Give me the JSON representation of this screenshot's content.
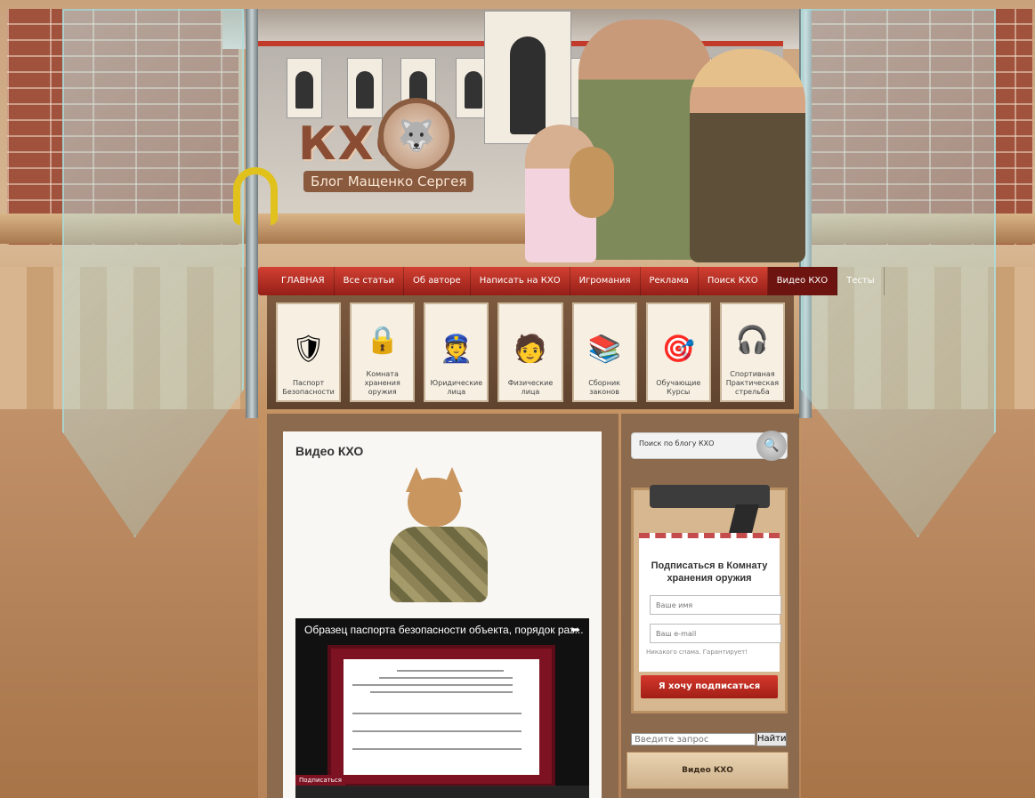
{
  "logo": {
    "letters": "КХО",
    "subtitle": "Блог Мащенко Сергея"
  },
  "nav": {
    "items": [
      {
        "label": "ГЛАВНАЯ"
      },
      {
        "label": "Все статьи"
      },
      {
        "label": "Об авторе"
      },
      {
        "label": "Написать на КХО"
      },
      {
        "label": "Игромания"
      },
      {
        "label": "Реклама"
      },
      {
        "label": "Поиск КХО"
      },
      {
        "label": "Видео КХО"
      },
      {
        "label": "Тесты"
      }
    ],
    "active_index": 7
  },
  "categories": [
    {
      "label": "Паспорт Безопасности",
      "icon": "shield-icon"
    },
    {
      "label": "Комната хранения оружия",
      "icon": "padlock-icon"
    },
    {
      "label": "Юридические лица",
      "icon": "guard-icon"
    },
    {
      "label": "Физические лица",
      "icon": "person-icon"
    },
    {
      "label": "Сборник законов",
      "icon": "books-icon"
    },
    {
      "label": "Обучающие Курсы",
      "icon": "target-icon"
    },
    {
      "label": "Спортивная Практическая стрельба",
      "icon": "headphones-icon"
    }
  ],
  "main": {
    "title": "Видео КХО",
    "video": {
      "title": "Образец паспорта безопасности объекта, порядок раз...",
      "subscribe_tag": "Подписаться"
    }
  },
  "sidebar": {
    "search": {
      "value": "Поиск по блогу КХО"
    },
    "subscribe": {
      "title": "Подписаться в Комнату хранения оружия",
      "name_placeholder": "Ваше имя",
      "email_placeholder": "Ваш e-mail",
      "nospam": "Никакого спама. Гарантирует!",
      "button": "Я хочу подписаться"
    },
    "query": {
      "placeholder": "Введите запрос",
      "button": "Найти"
    },
    "video_widget": {
      "title": "Видео КХО"
    }
  },
  "colors": {
    "nav_red": "#c23b2a",
    "nav_active": "#6e1410",
    "button_red": "#d5392c"
  }
}
